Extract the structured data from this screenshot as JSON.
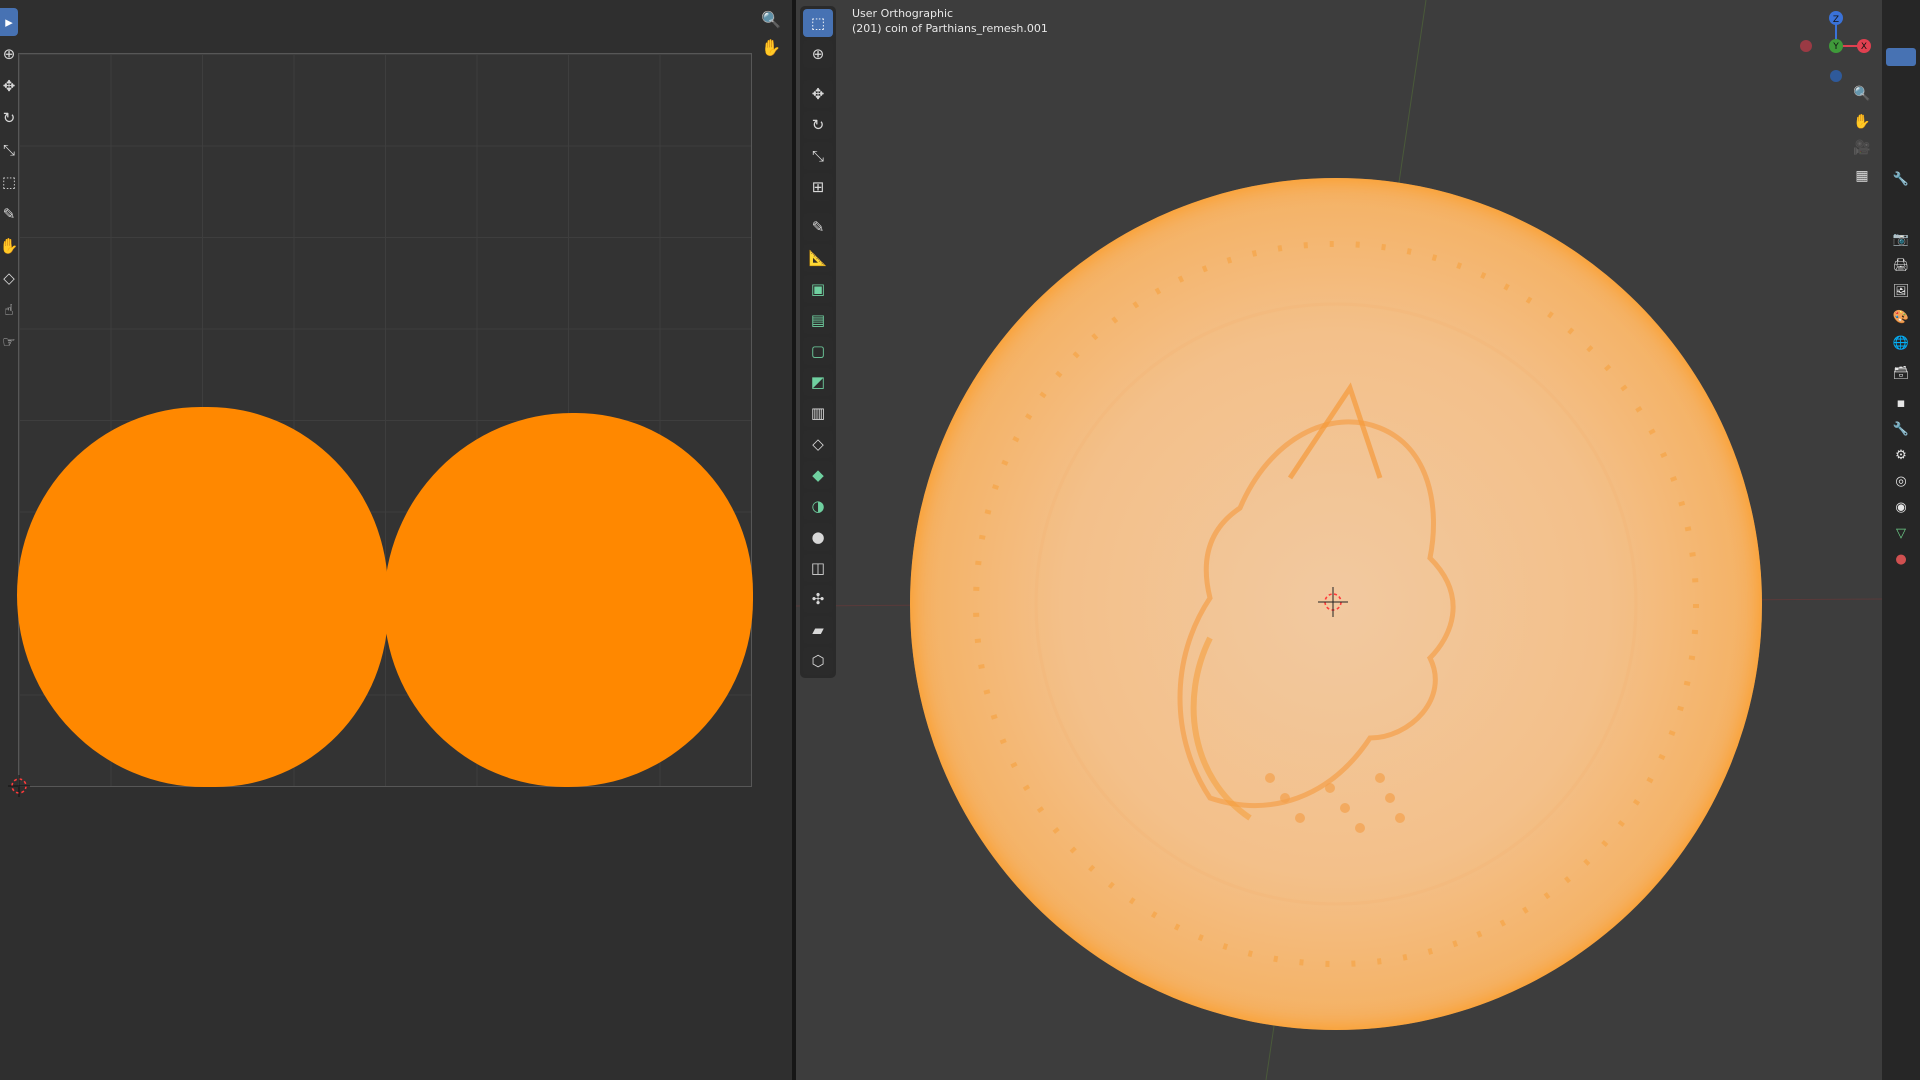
{
  "uv_editor": {
    "tools": [
      {
        "name": "select-box",
        "icon": "▸",
        "active": true
      },
      {
        "name": "cursor",
        "icon": "⊕"
      },
      {
        "name": "move",
        "icon": "✥"
      },
      {
        "name": "rotate",
        "icon": "↻"
      },
      {
        "name": "scale",
        "icon": "⤡"
      },
      {
        "name": "transform",
        "icon": "⬚"
      },
      {
        "name": "annotate",
        "icon": "✎"
      },
      {
        "name": "grab",
        "icon": "✋"
      },
      {
        "name": "relax",
        "icon": "◇"
      },
      {
        "name": "pinch",
        "icon": "☝"
      },
      {
        "name": "rip",
        "icon": "☞"
      }
    ],
    "zoom_icon": "🔍",
    "pan_icon": "✋",
    "island_color": "#ff8800"
  },
  "viewport": {
    "view_name": "User Orthographic",
    "object_label": "(201) coin of Parthians_remesh.001",
    "tools": [
      {
        "name": "select-box",
        "icon": "⬚",
        "active": true
      },
      {
        "name": "cursor",
        "icon": "⊕"
      },
      {
        "name": "move",
        "icon": "✥"
      },
      {
        "name": "rotate",
        "icon": "↻"
      },
      {
        "name": "scale",
        "icon": "⤡"
      },
      {
        "name": "transform",
        "icon": "⊞"
      },
      {
        "name": "annotate",
        "icon": "✎"
      },
      {
        "name": "measure",
        "icon": "📐"
      },
      {
        "name": "add-cube",
        "icon": "▣"
      },
      {
        "name": "extrude",
        "icon": "▤"
      },
      {
        "name": "inset",
        "icon": "▢"
      },
      {
        "name": "bevel",
        "icon": "◩"
      },
      {
        "name": "loop-cut",
        "icon": "▥"
      },
      {
        "name": "knife",
        "icon": "◇"
      },
      {
        "name": "poly-build",
        "icon": "◆"
      },
      {
        "name": "spin",
        "icon": "◑"
      },
      {
        "name": "smooth",
        "icon": "●"
      },
      {
        "name": "edge-slide",
        "icon": "◫"
      },
      {
        "name": "shrink-fatten",
        "icon": "✣"
      },
      {
        "name": "shear",
        "icon": "▰"
      },
      {
        "name": "rip-region",
        "icon": "⬡"
      }
    ],
    "gizmo": {
      "z": "Z",
      "y": "Y",
      "x": "X"
    },
    "nav_icons": {
      "zoom": "🔍",
      "pan": "✋",
      "camera": "🎥",
      "grid": "▦"
    }
  },
  "properties": {
    "icons": [
      "🔧",
      "📷",
      "🖨",
      "🖼",
      "🎨",
      "🌐",
      "🗃",
      "▪",
      "🔧",
      "⚙",
      "◎",
      "◉",
      "▽",
      "●"
    ]
  }
}
